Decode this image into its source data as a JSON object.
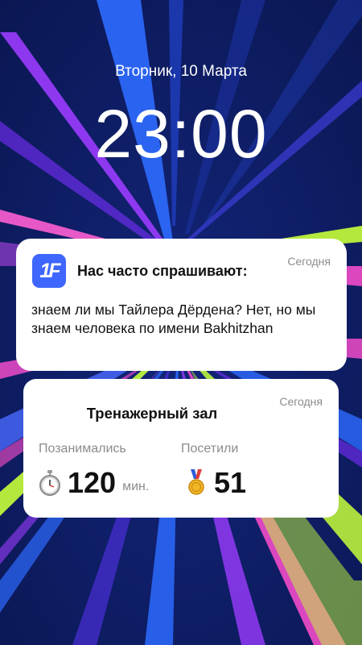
{
  "lockscreen": {
    "date": "Вторник, 10 Марта",
    "time": "23:00"
  },
  "notification": {
    "app_icon_text": "1F",
    "title": "Нас часто спрашивают:",
    "time": "Сегодня",
    "body": "знаем ли мы Тайлера Дёрдена? Нет, но мы знаем человека по имени Bakhitzhan"
  },
  "widget": {
    "title": "Тренажерный зал",
    "time": "Сегодня",
    "stats": [
      {
        "label": "Позанимались",
        "value": "120",
        "unit": "мин.",
        "icon": "stopwatch-icon"
      },
      {
        "label": "Посетили",
        "value": "51",
        "unit": "",
        "icon": "medal-icon"
      }
    ]
  },
  "colors": {
    "background": "#0c1a5c",
    "app_icon": "#3f67ff",
    "secondary_text": "#8c8c8c"
  }
}
